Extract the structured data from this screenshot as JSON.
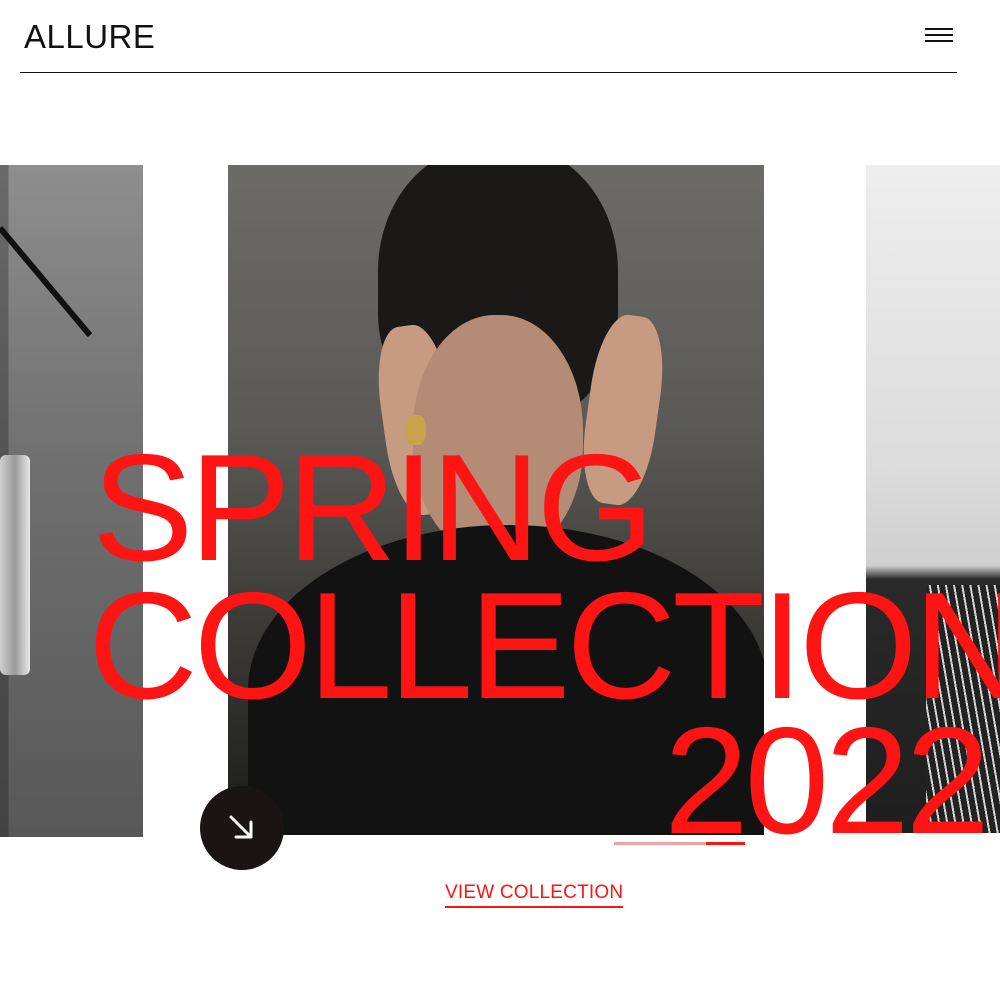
{
  "header": {
    "logo": "ALLURE",
    "menu_icon": "hamburger-menu-icon"
  },
  "hero": {
    "line1": "SPRING",
    "line2": "COLLECTION",
    "line3": "2022",
    "accent_color": "#ff1414",
    "next_icon": "arrow-down-right-icon",
    "slider_progress": 0.3,
    "cta_label": "VIEW COLLECTION"
  }
}
